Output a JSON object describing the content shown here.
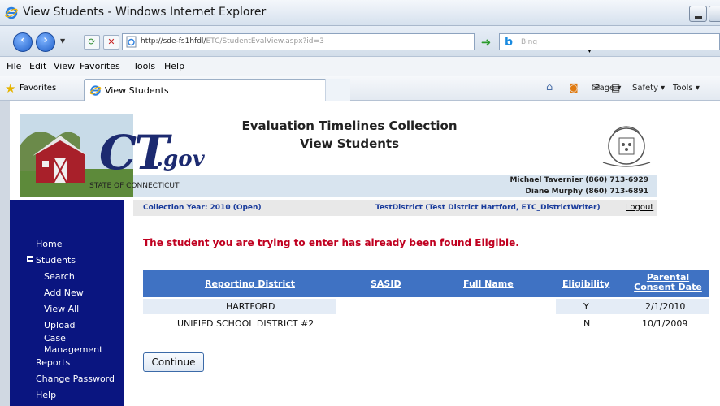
{
  "window": {
    "title": "View Students - Windows Internet Explorer"
  },
  "addressbar": {
    "url_host": "http://sde-fs1hfdl/",
    "url_path": "ETC/StudentEvalView.aspx?id=3",
    "search_placeholder": "Bing"
  },
  "menubar": {
    "items": [
      "File",
      "Edit",
      "View",
      "Favorites",
      "Tools",
      "Help"
    ]
  },
  "favbar": {
    "favorites_label": "Favorites",
    "tab_label": "View Students",
    "commands": [
      "Page ▾",
      "Safety ▾",
      "Tools ▾"
    ]
  },
  "header": {
    "logo_ct": "CT",
    "logo_gov": ".gov",
    "state_label": "STATE OF CONNECTICUT",
    "app_title_line1": "Evaluation Timelines Collection",
    "app_title_line2": "View Students",
    "contact1": "Michael Tavernier (860) 713-6929",
    "contact2": "Diane Murphy (860) 713-6891"
  },
  "navstrip": {
    "collection_year": "Collection Year: 2010 (Open)",
    "district": "TestDistrict (Test District Hartford, ETC_DistrictWriter)",
    "logout": "Logout"
  },
  "sidebar": {
    "home": "Home",
    "students": "Students",
    "search": "Search",
    "add_new": "Add New",
    "view_all": "View All",
    "upload": "Upload",
    "case_management_1": "Case",
    "case_management_2": "Management",
    "reports": "Reports",
    "change_password": "Change Password",
    "help": "Help"
  },
  "main": {
    "error_message": "The student you are trying to enter has already been found Eligible.",
    "continue_label": "Continue"
  },
  "table": {
    "headers": {
      "reporting_district": "Reporting District",
      "sasid": "SASID",
      "full_name": "Full Name",
      "eligibility": "Eligibility",
      "parental_line1": "Parental",
      "parental_line2": "Consent Date"
    },
    "rows": [
      {
        "reporting_district": "HARTFORD",
        "sasid": "",
        "full_name": "",
        "eligibility": "Y",
        "consent_date": "2/1/2010"
      },
      {
        "reporting_district": "UNIFIED SCHOOL DISTRICT #2",
        "sasid": "",
        "full_name": "",
        "eligibility": "N",
        "consent_date": "10/1/2009"
      }
    ]
  },
  "colors": {
    "sidebar_bg": "#0a1580",
    "table_header_bg": "#3f72c3",
    "error_text": "#c00020",
    "link_blue": "#1a3c9c"
  }
}
